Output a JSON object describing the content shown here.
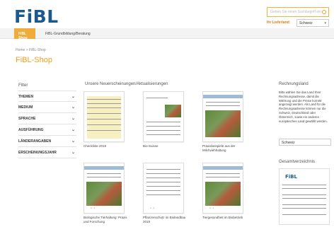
{
  "header": {
    "logo_text": "FiBL",
    "search_placeholder": "Geben Sie einen Suchbegriff ein",
    "region_label": "Ihr Lieferland:",
    "region_value": "Schweiz"
  },
  "nav": {
    "items": [
      {
        "label": "FiBL Shop"
      },
      {
        "label": "FiBL-Grundbildung/Beratung"
      }
    ]
  },
  "breadcrumb": "Home  >  FiBL-Shop",
  "page_title": "FiBL-Shop",
  "filter": {
    "heading": "Filter",
    "items": [
      {
        "label": "THEMEN"
      },
      {
        "label": "MEDIUM"
      },
      {
        "label": "SPRACHE"
      },
      {
        "label": "AUSFÜHRUNG"
      },
      {
        "label": "LÄNDERANGABEN"
      },
      {
        "label": "ERSCHEINUNGSJAHR"
      }
    ]
  },
  "section_title": "Unsere Neuerscheinungen/Aktualisierungen",
  "products": [
    {
      "caption": "Checkliste 2019"
    },
    {
      "caption": "Bio-Suisse"
    },
    {
      "caption": "Praxisbeispiele aus der Milchviehhaltung"
    },
    {
      "caption": "Biologische Tierhaltung: Praxis und Forschung"
    },
    {
      "caption": "Pflanzenschutz im Biolandbau 2019"
    },
    {
      "caption": "Tiergesundheit im Biobetrieb"
    }
  ],
  "right": {
    "heading_shipping": "Rechnungsland",
    "shipping_text": "Bitte wählen Sie das Land Ihrer Rechnungsadresse, damit die Währung und die Preise korrekt angezeigt werden. Als Land für die Rechnungsadresse können nur die Schweiz, Deutschland oder Österreich, sowie ein anderes europäisches Land gewählt werden.",
    "country_value": "Schweiz",
    "heading_catalog": "Gesamtverzeichnis",
    "catalog_logo": "FiBL"
  }
}
